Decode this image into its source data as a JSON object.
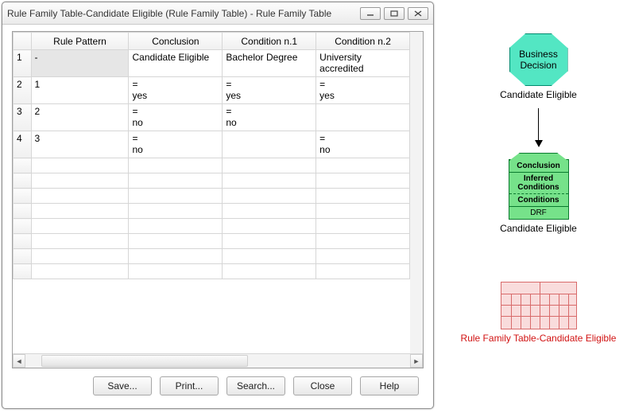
{
  "window": {
    "title": "Rule Family Table-Candidate Eligible (Rule Family Table) - Rule Family Table"
  },
  "grid": {
    "headers": {
      "rownum": "",
      "pattern": "Rule Pattern",
      "conclusion": "Conclusion",
      "cond1": "Condition n.1",
      "cond2": "Condition n.2"
    },
    "rows": [
      {
        "num": "1",
        "pattern": "-",
        "conclusion": "Candidate Eligible",
        "cond1": "Bachelor Degree",
        "cond2": "University accredited"
      },
      {
        "num": "2",
        "pattern": "1",
        "conclusion": "=\nyes",
        "cond1": "=\nyes",
        "cond2": "=\nyes"
      },
      {
        "num": "3",
        "pattern": "2",
        "conclusion": "=\nno",
        "cond1": "=\nno",
        "cond2": ""
      },
      {
        "num": "4",
        "pattern": "3",
        "conclusion": "=\nno",
        "cond1": "",
        "cond2": "=\nno"
      }
    ]
  },
  "buttons": {
    "save": "Save...",
    "print": "Print...",
    "search": "Search...",
    "close": "Close",
    "help": "Help"
  },
  "diagram": {
    "decision_line1": "Business",
    "decision_line2": "Decision",
    "decision_label": "Candidate Eligible",
    "drf": {
      "conclusion": "Conclusion",
      "inferred": "Inferred Conditions",
      "conditions": "Conditions",
      "drf": "DRF"
    },
    "drf_label": "Candidate Eligible",
    "table_label": "Rule Family Table-Candidate Eligible"
  }
}
